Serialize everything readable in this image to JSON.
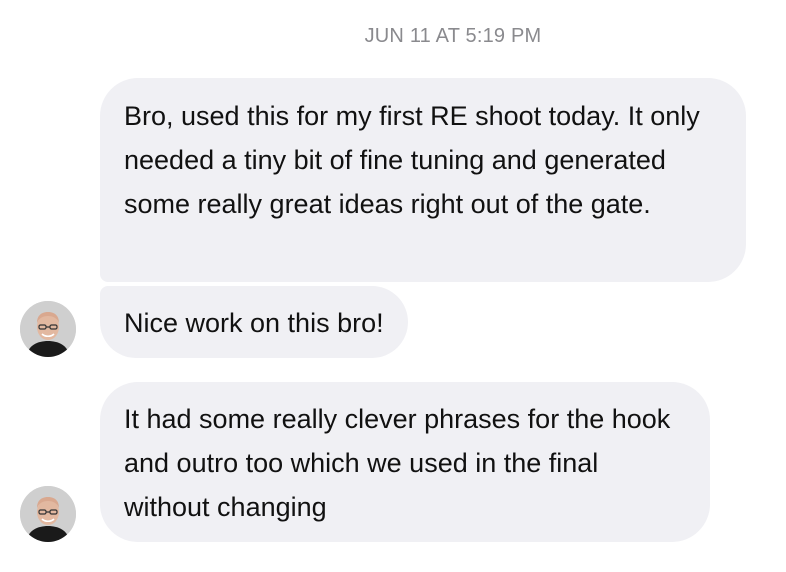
{
  "conversation": {
    "timestamp": "JUN 11 AT 5:19 PM",
    "messages": [
      {
        "sender": "other",
        "text": "Bro, used this for my first RE shoot today. It only needed a tiny bit of fine tuning and generated some really great ideas right out of the gate."
      },
      {
        "sender": "other",
        "text": "Nice work on this bro!"
      },
      {
        "sender": "other",
        "text": "It had some really clever phrases for the hook and outro too which we used in the final without changing"
      }
    ]
  },
  "icons": {
    "avatar": "person-avatar"
  },
  "colors": {
    "bubble_background": "#f0f0f4",
    "timestamp_text": "#8a8a8e",
    "message_text": "#111111"
  }
}
